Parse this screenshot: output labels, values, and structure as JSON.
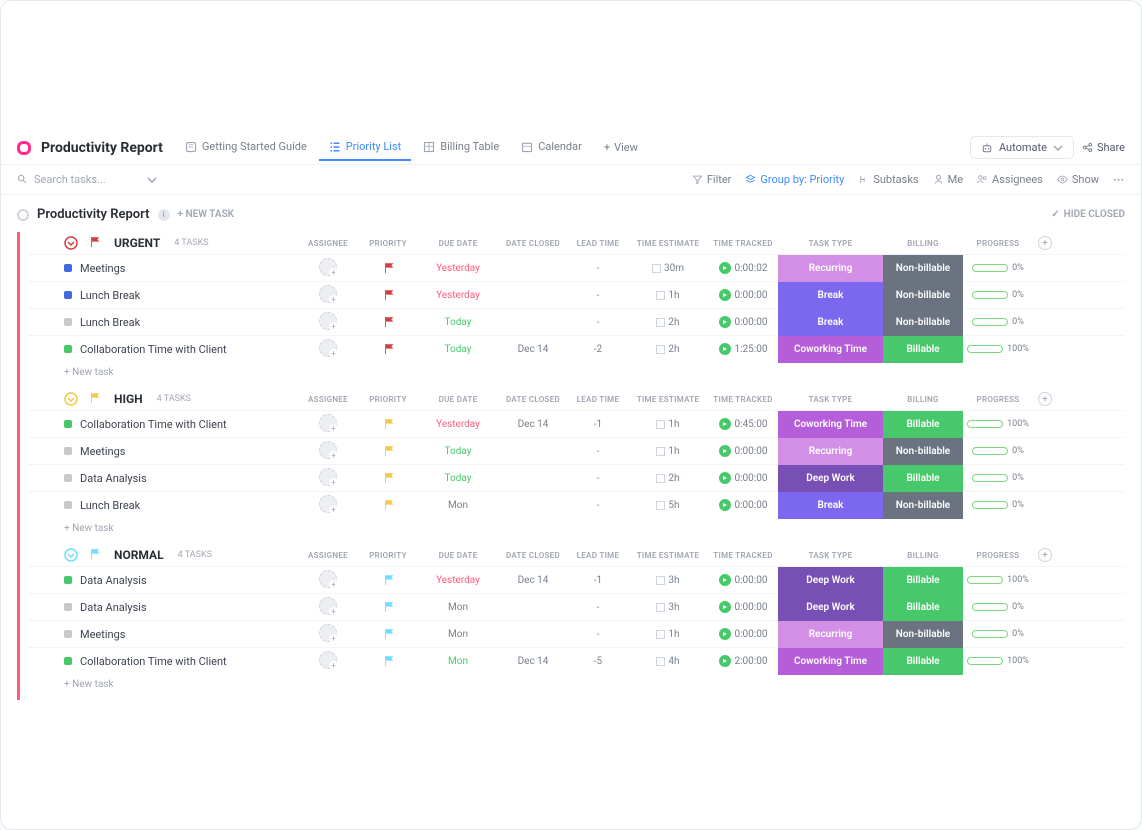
{
  "header": {
    "title": "Productivity Report",
    "tabs": [
      {
        "id": "getting-started",
        "icon": "book",
        "label": "Getting Started Guide"
      },
      {
        "id": "priority-list",
        "icon": "list-check",
        "label": "Priority List"
      },
      {
        "id": "billing-table",
        "icon": "table",
        "label": "Billing Table"
      },
      {
        "id": "calendar",
        "icon": "calendar",
        "label": "Calendar"
      }
    ],
    "active_tab": "priority-list",
    "add_view": "View",
    "automate": "Automate",
    "share": "Share"
  },
  "toolbar": {
    "search_placeholder": "Search tasks...",
    "filter": "Filter",
    "group_by": "Group by: Priority",
    "subtasks": "Subtasks",
    "me": "Me",
    "assignees": "Assignees",
    "show": "Show"
  },
  "report": {
    "title": "Productivity Report",
    "new_task": "+ NEW TASK",
    "hide_closed": "HIDE CLOSED"
  },
  "columns": [
    "ASSIGNEE",
    "PRIORITY",
    "DUE DATE",
    "DATE CLOSED",
    "LEAD TIME",
    "TIME ESTIMATE",
    "TIME TRACKED",
    "TASK TYPE",
    "BILLING",
    "PROGRESS"
  ],
  "task_type_colors": {
    "Recurring": "#d38ee6",
    "Break": "#7b68ee",
    "Coworking Time": "#b55ed9",
    "Deep Work": "#7850b5"
  },
  "billing_colors": {
    "Non-billable": "#6b7280",
    "Billable": "#47c96b"
  },
  "new_task_row": "+ New task",
  "groups": [
    {
      "name": "URGENT",
      "flag_color": "#d33d44",
      "count_label": "4 TASKS",
      "tasks": [
        {
          "status": "#4169e1",
          "name": "Meetings",
          "priority": "#d33d44",
          "due": "Yesterday",
          "due_cls": "due-yesterday",
          "closed": "",
          "lead": "-",
          "estimate": "30m",
          "tracked": "0:00:02",
          "task_type": "Recurring",
          "billing": "Non-billable",
          "progress": 0
        },
        {
          "status": "#4169e1",
          "name": "Lunch Break",
          "priority": "#d33d44",
          "due": "Yesterday",
          "due_cls": "due-yesterday",
          "closed": "",
          "lead": "-",
          "estimate": "1h",
          "tracked": "0:00:00",
          "task_type": "Break",
          "billing": "Non-billable",
          "progress": 0
        },
        {
          "status": "#c8c8c8",
          "name": "Lunch Break",
          "priority": "#d33d44",
          "due": "Today",
          "due_cls": "due-today",
          "closed": "",
          "lead": "-",
          "estimate": "2h",
          "tracked": "0:00:00",
          "task_type": "Break",
          "billing": "Non-billable",
          "progress": 0
        },
        {
          "status": "#47c96b",
          "name": "Collaboration Time with Client",
          "priority": "#d33d44",
          "due": "Today",
          "due_cls": "due-today",
          "closed": "Dec 14",
          "lead": "-2",
          "estimate": "2h",
          "tracked": "1:25:00",
          "task_type": "Coworking Time",
          "billing": "Billable",
          "progress": 100
        }
      ]
    },
    {
      "name": "HIGH",
      "flag_color": "#f0c94a",
      "count_label": "4 TASKS",
      "tasks": [
        {
          "status": "#47c96b",
          "name": "Collaboration Time with Client",
          "priority": "#f0c94a",
          "due": "Yesterday",
          "due_cls": "due-yesterday",
          "closed": "Dec 14",
          "lead": "-1",
          "estimate": "1h",
          "tracked": "0:45:00",
          "task_type": "Coworking Time",
          "billing": "Billable",
          "progress": 100
        },
        {
          "status": "#c8c8c8",
          "name": "Meetings",
          "priority": "#f0c94a",
          "due": "Today",
          "due_cls": "due-today",
          "closed": "",
          "lead": "-",
          "estimate": "1h",
          "tracked": "0:00:00",
          "task_type": "Recurring",
          "billing": "Non-billable",
          "progress": 0
        },
        {
          "status": "#c8c8c8",
          "name": "Data Analysis",
          "priority": "#f0c94a",
          "due": "Today",
          "due_cls": "due-today",
          "closed": "",
          "lead": "-",
          "estimate": "2h",
          "tracked": "0:00:00",
          "task_type": "Deep Work",
          "billing": "Billable",
          "progress": 0
        },
        {
          "status": "#c8c8c8",
          "name": "Lunch Break",
          "priority": "#f0c94a",
          "due": "Mon",
          "due_cls": "due-mon",
          "closed": "",
          "lead": "-",
          "estimate": "5h",
          "tracked": "0:00:00",
          "task_type": "Break",
          "billing": "Non-billable",
          "progress": 0
        }
      ]
    },
    {
      "name": "NORMAL",
      "flag_color": "#6fddff",
      "count_label": "4 TASKS",
      "tasks": [
        {
          "status": "#47c96b",
          "name": "Data Analysis",
          "priority": "#6fddff",
          "due": "Yesterday",
          "due_cls": "due-yesterday",
          "closed": "Dec 14",
          "lead": "-1",
          "estimate": "3h",
          "tracked": "0:00:00",
          "task_type": "Deep Work",
          "billing": "Billable",
          "progress": 100
        },
        {
          "status": "#c8c8c8",
          "name": "Data Analysis",
          "priority": "#6fddff",
          "due": "Mon",
          "due_cls": "due-mon",
          "closed": "",
          "lead": "-",
          "estimate": "3h",
          "tracked": "0:00:00",
          "task_type": "Deep Work",
          "billing": "Billable",
          "progress": 0
        },
        {
          "status": "#c8c8c8",
          "name": "Meetings",
          "priority": "#6fddff",
          "due": "Mon",
          "due_cls": "due-mon",
          "closed": "",
          "lead": "-",
          "estimate": "1h",
          "tracked": "0:00:00",
          "task_type": "Recurring",
          "billing": "Non-billable",
          "progress": 0
        },
        {
          "status": "#47c96b",
          "name": "Collaboration Time with Client",
          "priority": "#6fddff",
          "due": "Mon",
          "due_cls": "due-mongreen",
          "closed": "Dec 14",
          "lead": "-5",
          "estimate": "4h",
          "tracked": "2:00:00",
          "task_type": "Coworking Time",
          "billing": "Billable",
          "progress": 100
        }
      ]
    }
  ]
}
